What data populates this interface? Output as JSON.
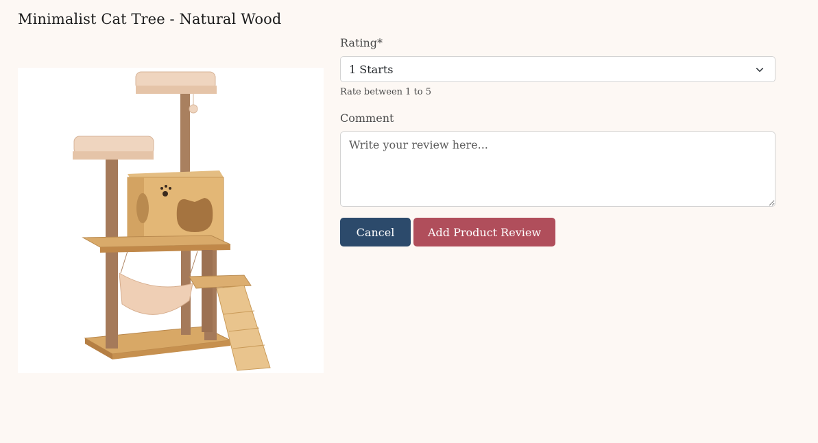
{
  "product": {
    "title": "Minimalist Cat Tree - Natural Wood",
    "image_alt": "Minimalist cat tree with natural wood platforms, condo, hammock and ramp"
  },
  "form": {
    "rating_label": "Rating*",
    "rating_selected": "1 Starts",
    "rating_help": "Rate between 1 to 5",
    "comment_label": "Comment",
    "comment_placeholder": "Write your review here...",
    "comment_value": ""
  },
  "actions": {
    "cancel_label": "Cancel",
    "submit_label": "Add Product Review"
  },
  "colors": {
    "background": "#fdf8f4",
    "cancel_button": "#2c4a6b",
    "submit_button": "#b04e5b"
  }
}
